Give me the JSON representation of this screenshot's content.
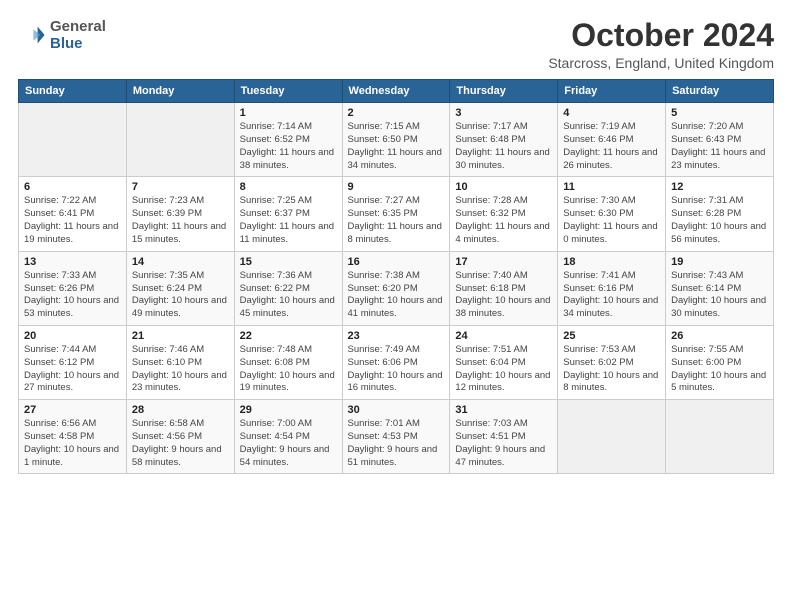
{
  "header": {
    "logo_line1": "General",
    "logo_line2": "Blue",
    "month": "October 2024",
    "location": "Starcross, England, United Kingdom"
  },
  "days_of_week": [
    "Sunday",
    "Monday",
    "Tuesday",
    "Wednesday",
    "Thursday",
    "Friday",
    "Saturday"
  ],
  "weeks": [
    [
      {
        "day": "",
        "info": ""
      },
      {
        "day": "",
        "info": ""
      },
      {
        "day": "1",
        "info": "Sunrise: 7:14 AM\nSunset: 6:52 PM\nDaylight: 11 hours and 38 minutes."
      },
      {
        "day": "2",
        "info": "Sunrise: 7:15 AM\nSunset: 6:50 PM\nDaylight: 11 hours and 34 minutes."
      },
      {
        "day": "3",
        "info": "Sunrise: 7:17 AM\nSunset: 6:48 PM\nDaylight: 11 hours and 30 minutes."
      },
      {
        "day": "4",
        "info": "Sunrise: 7:19 AM\nSunset: 6:46 PM\nDaylight: 11 hours and 26 minutes."
      },
      {
        "day": "5",
        "info": "Sunrise: 7:20 AM\nSunset: 6:43 PM\nDaylight: 11 hours and 23 minutes."
      }
    ],
    [
      {
        "day": "6",
        "info": "Sunrise: 7:22 AM\nSunset: 6:41 PM\nDaylight: 11 hours and 19 minutes."
      },
      {
        "day": "7",
        "info": "Sunrise: 7:23 AM\nSunset: 6:39 PM\nDaylight: 11 hours and 15 minutes."
      },
      {
        "day": "8",
        "info": "Sunrise: 7:25 AM\nSunset: 6:37 PM\nDaylight: 11 hours and 11 minutes."
      },
      {
        "day": "9",
        "info": "Sunrise: 7:27 AM\nSunset: 6:35 PM\nDaylight: 11 hours and 8 minutes."
      },
      {
        "day": "10",
        "info": "Sunrise: 7:28 AM\nSunset: 6:32 PM\nDaylight: 11 hours and 4 minutes."
      },
      {
        "day": "11",
        "info": "Sunrise: 7:30 AM\nSunset: 6:30 PM\nDaylight: 11 hours and 0 minutes."
      },
      {
        "day": "12",
        "info": "Sunrise: 7:31 AM\nSunset: 6:28 PM\nDaylight: 10 hours and 56 minutes."
      }
    ],
    [
      {
        "day": "13",
        "info": "Sunrise: 7:33 AM\nSunset: 6:26 PM\nDaylight: 10 hours and 53 minutes."
      },
      {
        "day": "14",
        "info": "Sunrise: 7:35 AM\nSunset: 6:24 PM\nDaylight: 10 hours and 49 minutes."
      },
      {
        "day": "15",
        "info": "Sunrise: 7:36 AM\nSunset: 6:22 PM\nDaylight: 10 hours and 45 minutes."
      },
      {
        "day": "16",
        "info": "Sunrise: 7:38 AM\nSunset: 6:20 PM\nDaylight: 10 hours and 41 minutes."
      },
      {
        "day": "17",
        "info": "Sunrise: 7:40 AM\nSunset: 6:18 PM\nDaylight: 10 hours and 38 minutes."
      },
      {
        "day": "18",
        "info": "Sunrise: 7:41 AM\nSunset: 6:16 PM\nDaylight: 10 hours and 34 minutes."
      },
      {
        "day": "19",
        "info": "Sunrise: 7:43 AM\nSunset: 6:14 PM\nDaylight: 10 hours and 30 minutes."
      }
    ],
    [
      {
        "day": "20",
        "info": "Sunrise: 7:44 AM\nSunset: 6:12 PM\nDaylight: 10 hours and 27 minutes."
      },
      {
        "day": "21",
        "info": "Sunrise: 7:46 AM\nSunset: 6:10 PM\nDaylight: 10 hours and 23 minutes."
      },
      {
        "day": "22",
        "info": "Sunrise: 7:48 AM\nSunset: 6:08 PM\nDaylight: 10 hours and 19 minutes."
      },
      {
        "day": "23",
        "info": "Sunrise: 7:49 AM\nSunset: 6:06 PM\nDaylight: 10 hours and 16 minutes."
      },
      {
        "day": "24",
        "info": "Sunrise: 7:51 AM\nSunset: 6:04 PM\nDaylight: 10 hours and 12 minutes."
      },
      {
        "day": "25",
        "info": "Sunrise: 7:53 AM\nSunset: 6:02 PM\nDaylight: 10 hours and 8 minutes."
      },
      {
        "day": "26",
        "info": "Sunrise: 7:55 AM\nSunset: 6:00 PM\nDaylight: 10 hours and 5 minutes."
      }
    ],
    [
      {
        "day": "27",
        "info": "Sunrise: 6:56 AM\nSunset: 4:58 PM\nDaylight: 10 hours and 1 minute."
      },
      {
        "day": "28",
        "info": "Sunrise: 6:58 AM\nSunset: 4:56 PM\nDaylight: 9 hours and 58 minutes."
      },
      {
        "day": "29",
        "info": "Sunrise: 7:00 AM\nSunset: 4:54 PM\nDaylight: 9 hours and 54 minutes."
      },
      {
        "day": "30",
        "info": "Sunrise: 7:01 AM\nSunset: 4:53 PM\nDaylight: 9 hours and 51 minutes."
      },
      {
        "day": "31",
        "info": "Sunrise: 7:03 AM\nSunset: 4:51 PM\nDaylight: 9 hours and 47 minutes."
      },
      {
        "day": "",
        "info": ""
      },
      {
        "day": "",
        "info": ""
      }
    ]
  ]
}
